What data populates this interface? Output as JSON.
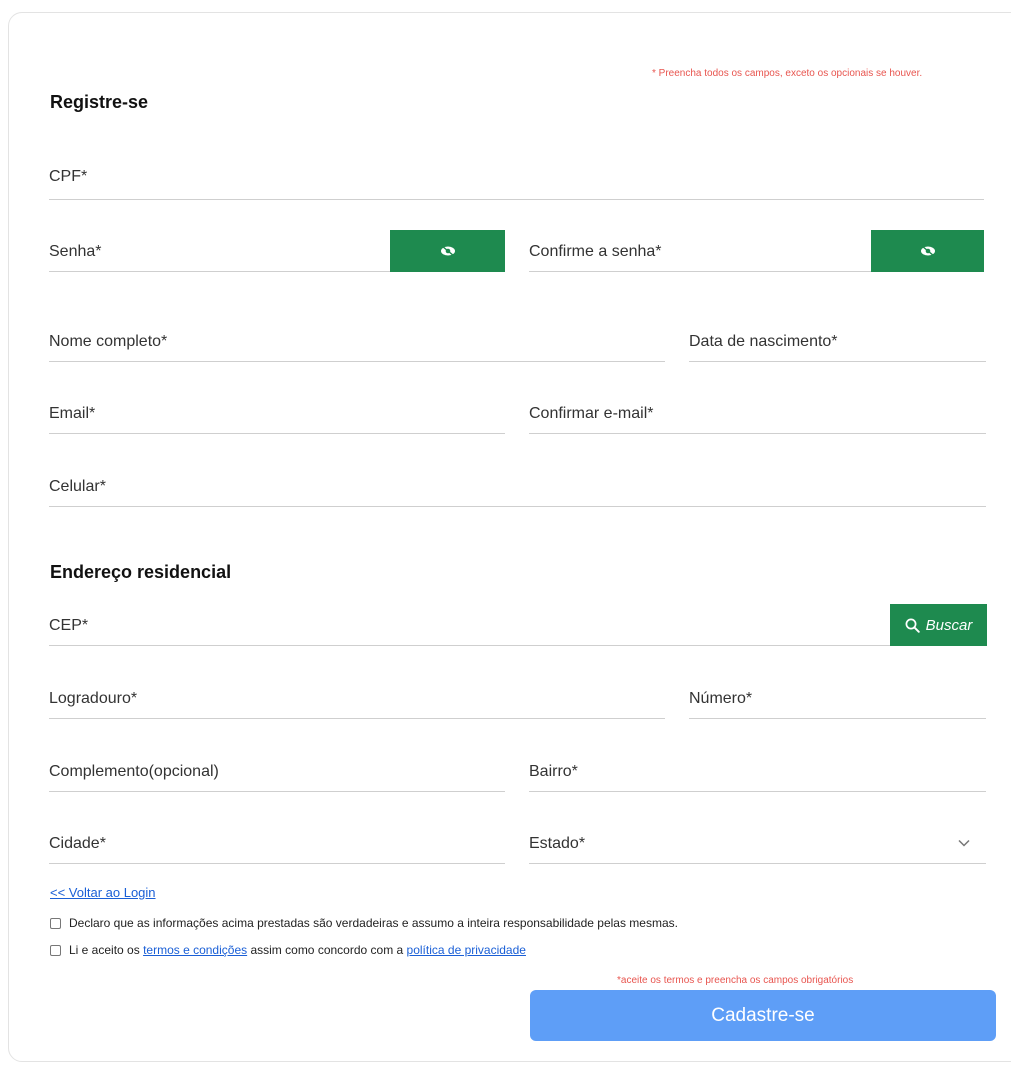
{
  "form": {
    "required_note": "* Preencha todos os campos, exceto os opcionais se houver.",
    "title": "Registre-se",
    "fields": {
      "cpf": "CPF*",
      "senha": "Senha*",
      "confirme_senha": "Confirme a senha*",
      "nome": "Nome completo*",
      "nascimento": "Data de nascimento*",
      "email": "Email*",
      "confirmar_email": "Confirmar e-mail*",
      "celular": "Celular*"
    }
  },
  "address": {
    "title": "Endereço residencial",
    "fields": {
      "cep": "CEP*",
      "logradouro": "Logradouro*",
      "numero": "Número*",
      "complemento": "Complemento(opcional)",
      "bairro": "Bairro*",
      "cidade": "Cidade*",
      "estado": "Estado*"
    },
    "search_label": "Buscar"
  },
  "footer": {
    "back_link": "<< Voltar ao Login",
    "declaration": "Declaro que as informações acima prestadas são verdadeiras e assumo a inteira responsabilidade pelas mesmas.",
    "terms_prefix": "Li e aceito os",
    "terms_link": "termos e condições",
    "terms_middle": "assim como concordo com a",
    "privacy_link": "política de privacidade",
    "warning": "*aceite os termos e preencha os campos obrigatórios",
    "submit_label": "Cadastre-se"
  },
  "colors": {
    "accent_green": "#1e8a4f",
    "submit_blue": "#5e9ef7",
    "warning_red": "#e8554f",
    "link_blue": "#1a5fd6"
  },
  "icons": {
    "password_toggle": "eye-slash-icon",
    "search": "search-icon",
    "dropdown": "chevron-down-icon"
  }
}
